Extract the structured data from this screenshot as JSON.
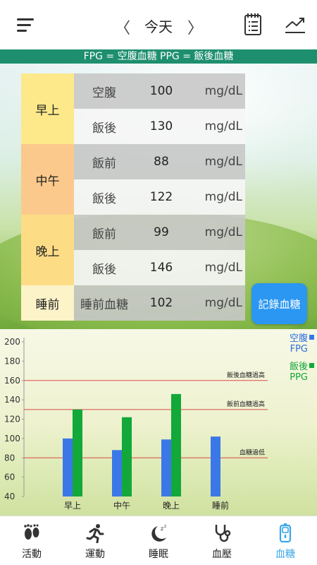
{
  "header": {
    "title": "今天",
    "prev_label": "〈",
    "next_label": "〉"
  },
  "legend_strip": "FPG = 空腹血糖   PPG = 飯後血糖",
  "periods": [
    {
      "name": "早上",
      "color": "#fde98a",
      "rows": [
        {
          "label": "空腹",
          "value": "100",
          "unit": "mg/dL"
        },
        {
          "label": "飯後",
          "value": "130",
          "unit": "mg/dL"
        }
      ]
    },
    {
      "name": "中午",
      "color": "#fbc98c",
      "rows": [
        {
          "label": "飯前",
          "value": "88",
          "unit": "mg/dL"
        },
        {
          "label": "飯後",
          "value": "122",
          "unit": "mg/dL"
        }
      ]
    },
    {
      "name": "晚上",
      "color": "#fddc86",
      "rows": [
        {
          "label": "飯前",
          "value": "99",
          "unit": "mg/dL"
        },
        {
          "label": "飯後",
          "value": "146",
          "unit": "mg/dL"
        }
      ]
    },
    {
      "name": "睡前",
      "color": "#fdf3c8",
      "rows": [
        {
          "label": "睡前血糖",
          "value": "102",
          "unit": "mg/dL"
        }
      ]
    }
  ],
  "record_button": "記錄血糖",
  "chart_legend": {
    "fpg_line1": "空腹",
    "fpg_line2": "FPG",
    "ppg_line1": "飯後",
    "ppg_line2": "PPG"
  },
  "chart_data": {
    "type": "bar",
    "categories": [
      "早上",
      "中午",
      "晚上",
      "睡前"
    ],
    "series": [
      {
        "name": "空腹 FPG",
        "color": "#3b78e7",
        "values": [
          100,
          88,
          99,
          102
        ]
      },
      {
        "name": "飯後 PPG",
        "color": "#12a83a",
        "values": [
          130,
          122,
          146,
          null
        ]
      }
    ],
    "ylim": [
      40,
      200
    ],
    "yticks": [
      40,
      60,
      80,
      100,
      120,
      140,
      160,
      180,
      200
    ],
    "reference_lines": [
      {
        "value": 160,
        "label": "飯後血糖過高",
        "color": "#d94a4a"
      },
      {
        "value": 130,
        "label": "飯前血糖過高",
        "color": "#d94a4a"
      },
      {
        "value": 80,
        "label": "血糖過低",
        "color": "#d94a4a"
      }
    ]
  },
  "bottom_nav": [
    {
      "label": "活動",
      "icon": "footprints-icon",
      "active": false
    },
    {
      "label": "運動",
      "icon": "running-icon",
      "active": false
    },
    {
      "label": "睡眠",
      "icon": "sleep-icon",
      "active": false
    },
    {
      "label": "血壓",
      "icon": "stethoscope-icon",
      "active": false
    },
    {
      "label": "血糖",
      "icon": "glucose-meter-icon",
      "active": true
    }
  ],
  "colors": {
    "accent": "#1e8f6e",
    "record_button": "#2b97f2",
    "active_nav": "#39a7e8"
  }
}
